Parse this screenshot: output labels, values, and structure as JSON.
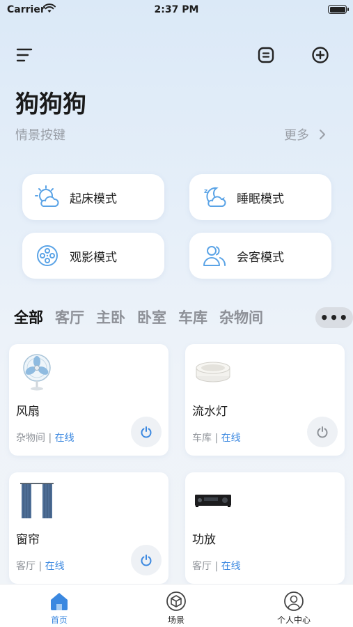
{
  "status_bar": {
    "carrier": "Carrier",
    "time": "2:37 PM"
  },
  "header": {
    "title": "狗狗狗",
    "subtitle": "情景按键",
    "more_label": "更多"
  },
  "scenes": [
    {
      "label": "起床模式",
      "icon": "sunrise-cloud-icon"
    },
    {
      "label": "睡眠模式",
      "icon": "moon-cloud-icon"
    },
    {
      "label": "观影模式",
      "icon": "film-reel-icon"
    },
    {
      "label": "会客模式",
      "icon": "people-icon"
    }
  ],
  "rooms": {
    "tabs": [
      "全部",
      "客厅",
      "主卧",
      "卧室",
      "车库",
      "杂物间"
    ],
    "active": "全部",
    "more_label": "•••"
  },
  "devices": [
    {
      "name": "风扇",
      "room": "杂物间",
      "separator": " | ",
      "status": "在线",
      "image": "fan-image",
      "power_active": true
    },
    {
      "name": "流水灯",
      "room": "车库",
      "separator": " | ",
      "status": "在线",
      "image": "led-strip-image",
      "power_active": false
    },
    {
      "name": "窗帘",
      "room": "客厅",
      "separator": " | ",
      "status": "在线",
      "image": "curtain-image",
      "power_active": true
    },
    {
      "name": "功放",
      "room": "客厅",
      "separator": " | ",
      "status": "在线",
      "image": "amplifier-image",
      "power_active": false
    }
  ],
  "tabbar": [
    {
      "label": "首页",
      "icon": "home-icon",
      "active": true
    },
    {
      "label": "场景",
      "icon": "cube-icon",
      "active": false
    },
    {
      "label": "个人中心",
      "icon": "user-circle-icon",
      "active": false
    }
  ],
  "colors": {
    "accent": "#3b88e0",
    "scene_icon": "#5aa3e6",
    "power_active": "#3b88e0",
    "power_inactive": "#8e9298"
  }
}
